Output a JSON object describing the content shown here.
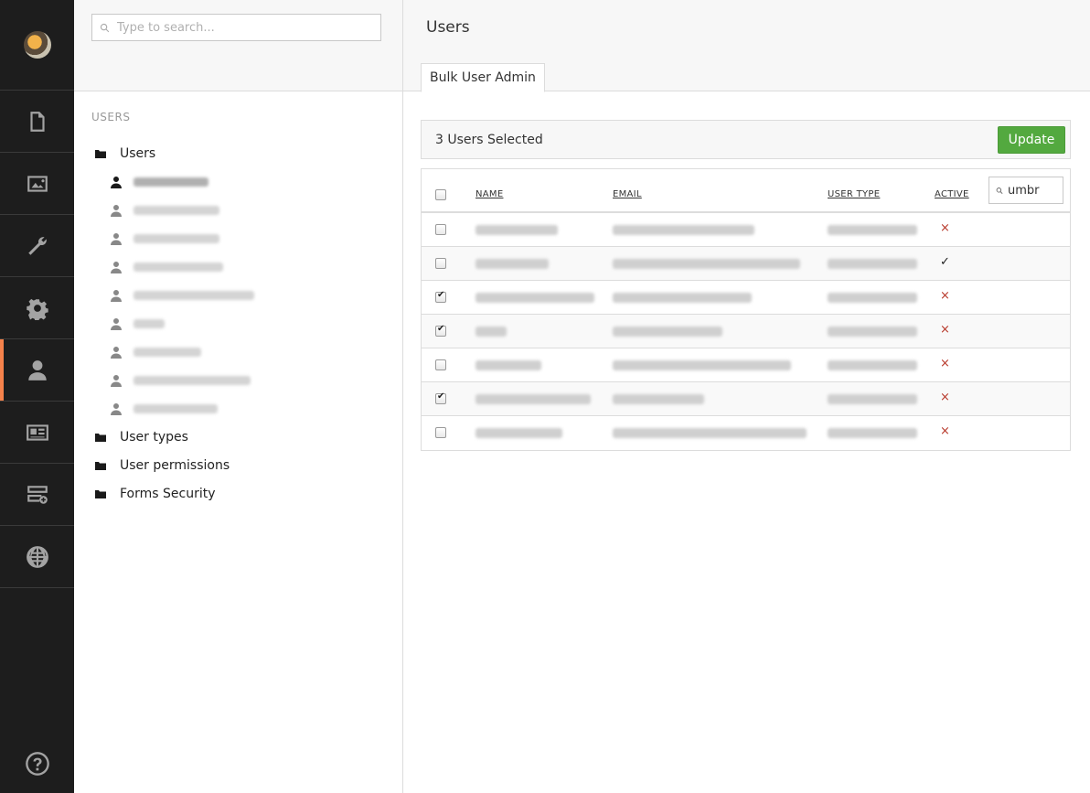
{
  "tree": {
    "search_placeholder": "Type to search...",
    "heading": "USERS",
    "root_label": "Users",
    "user_count": 9,
    "folders": [
      "User types",
      "User permissions",
      "Forms Security"
    ]
  },
  "main": {
    "title": "Users",
    "tab_label": "Bulk User Admin",
    "selected_text": "3 Users Selected",
    "update_label": "Update"
  },
  "grid": {
    "headers": {
      "name": "NAME",
      "email": "EMAIL",
      "user_type": "USER TYPE",
      "active": "ACTIVE"
    },
    "filter_value": "umbr",
    "rows": [
      {
        "selected": false,
        "active": false
      },
      {
        "selected": false,
        "active": true
      },
      {
        "selected": true,
        "active": false
      },
      {
        "selected": true,
        "active": false
      },
      {
        "selected": false,
        "active": false
      },
      {
        "selected": true,
        "active": false
      },
      {
        "selected": false,
        "active": false
      }
    ],
    "active_symbols": {
      "yes": "✓",
      "no": "×"
    }
  },
  "icons": {
    "nav": [
      "content-icon",
      "media-icon",
      "developer-icon",
      "settings-icon",
      "users-icon",
      "members-icon",
      "forms-icon",
      "translation-icon",
      "help-icon"
    ]
  },
  "colors": {
    "accent": "#f5824b",
    "update_button": "#53a93f",
    "sidebar": "#1d1d1d",
    "inactive_mark": "#b83a2c"
  }
}
